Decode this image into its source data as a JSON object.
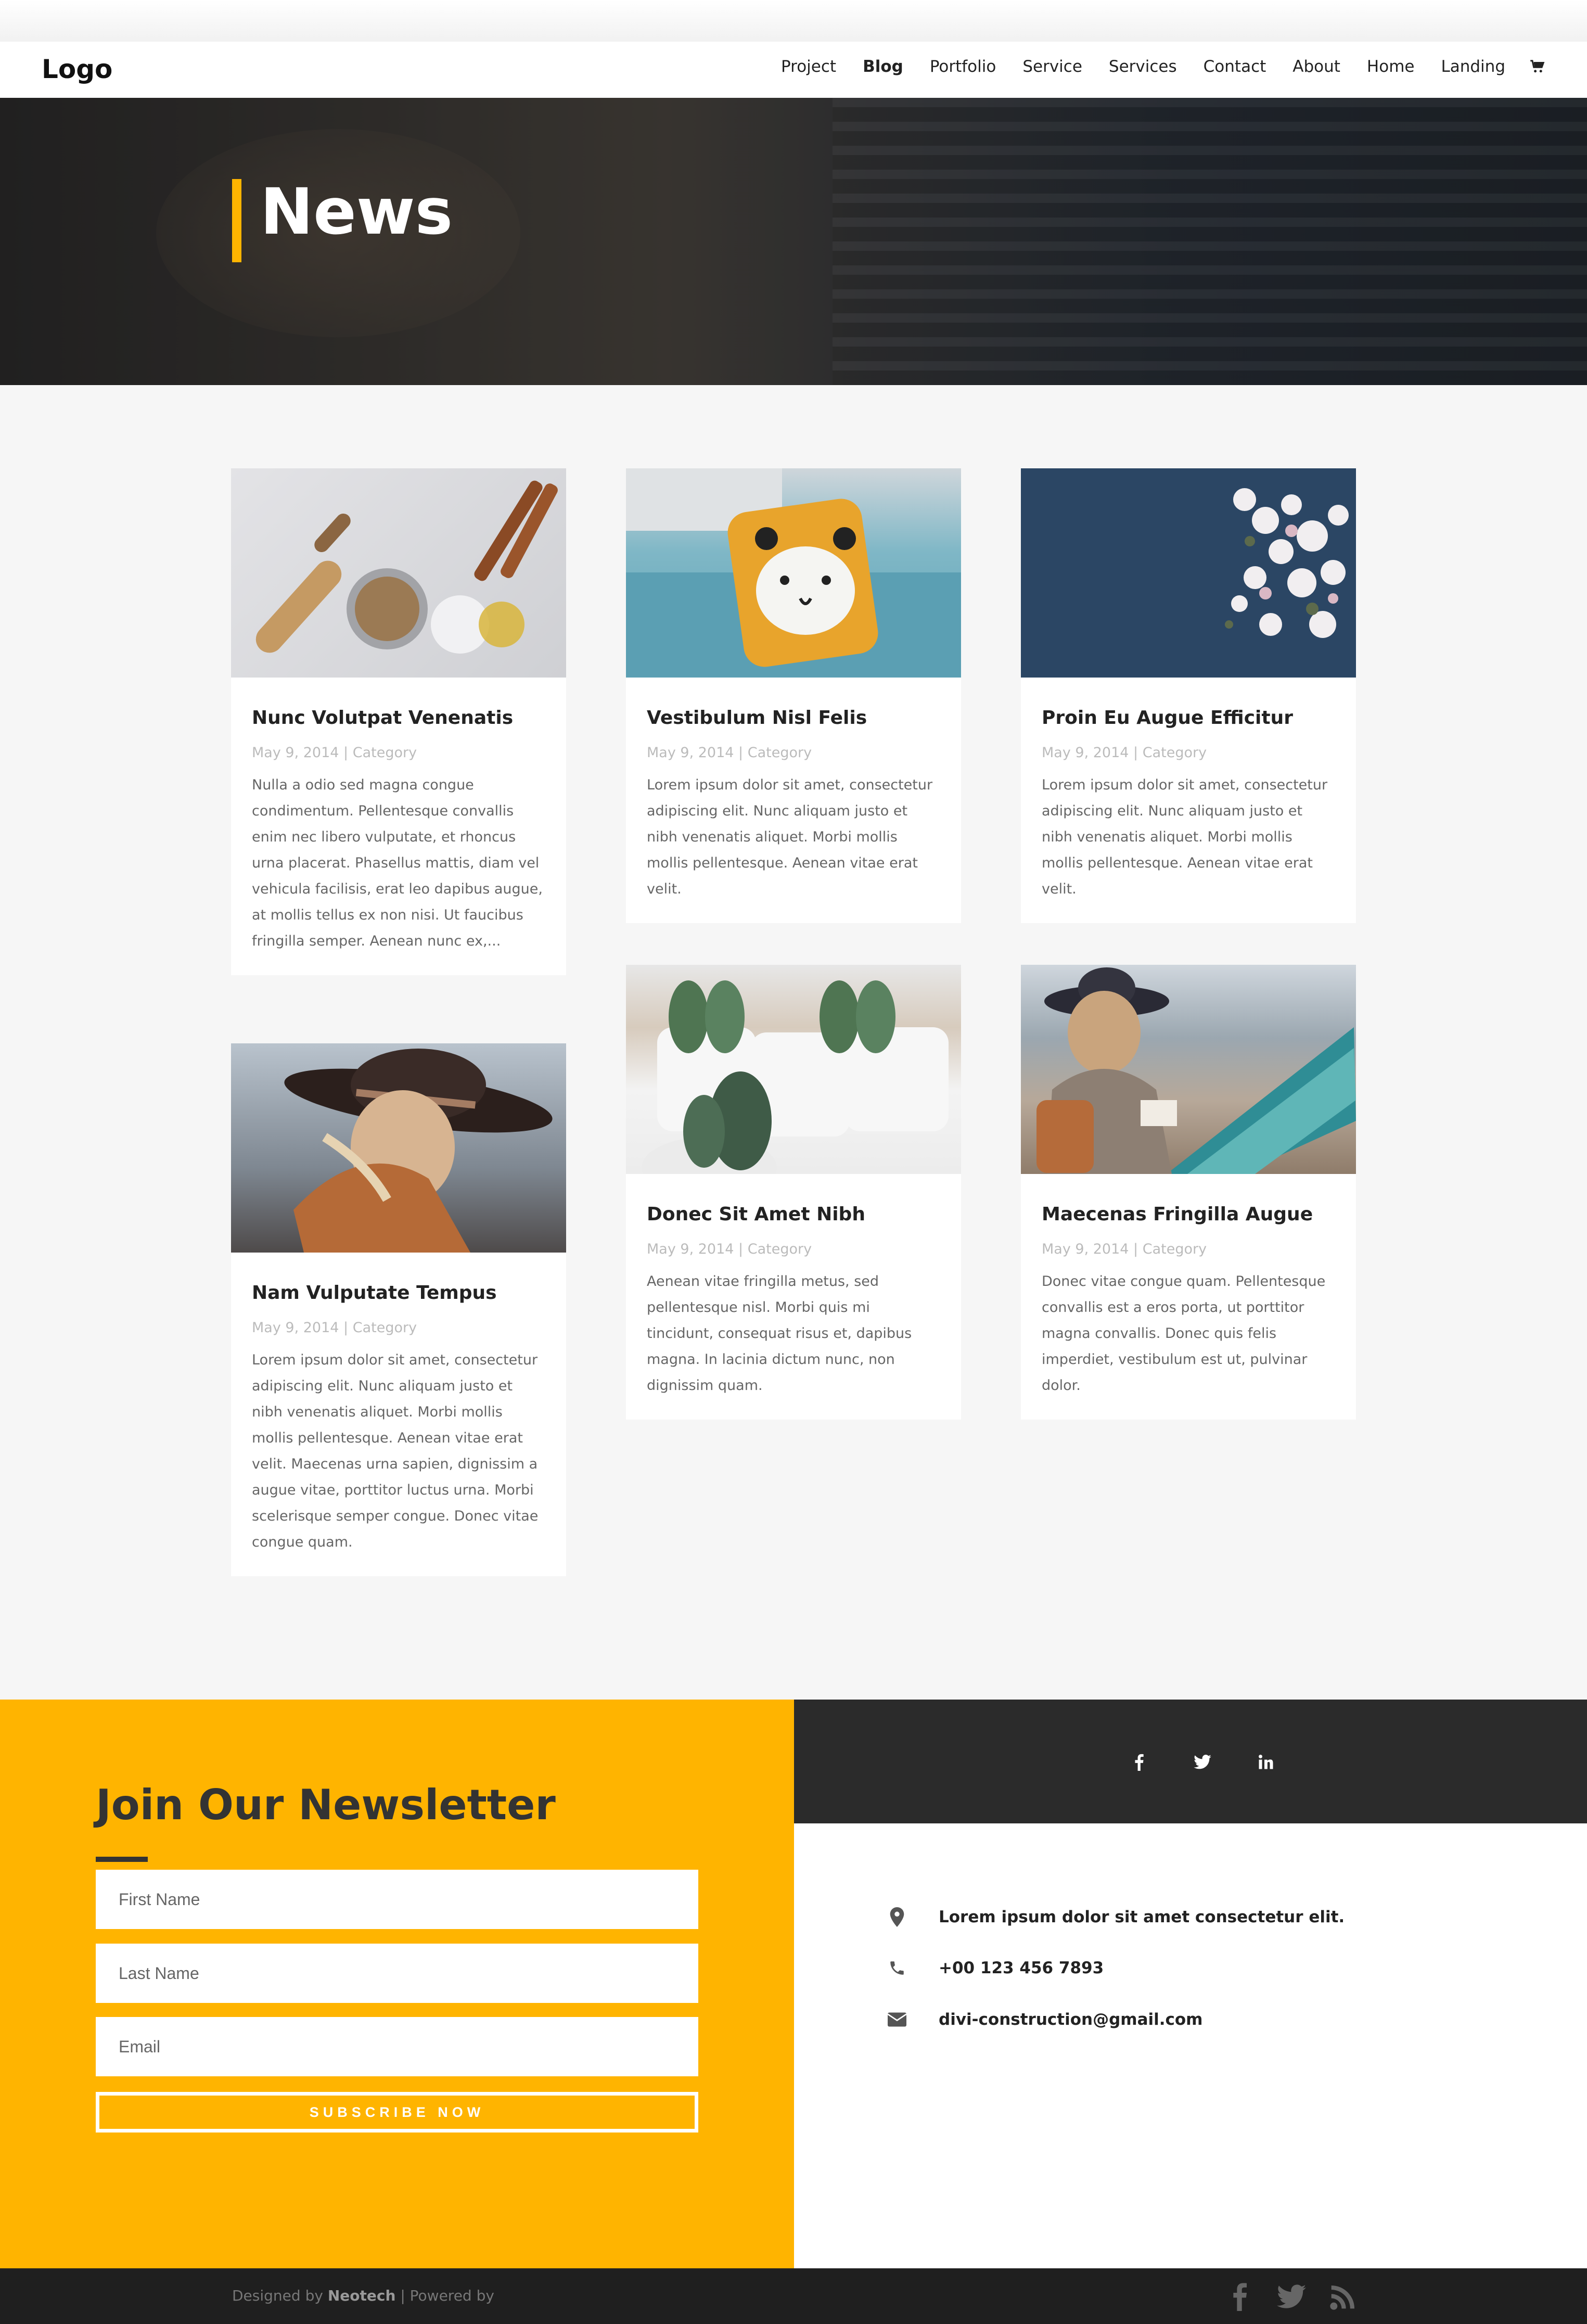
{
  "header": {
    "logo": "Logo",
    "nav": [
      "Project",
      "Blog",
      "Portfolio",
      "Service",
      "Services",
      "Contact",
      "About",
      "Home",
      "Landing"
    ],
    "active": "Blog"
  },
  "hero": {
    "title": "News"
  },
  "colors": {
    "accent": "#ffb400",
    "dark": "#2b2b2b",
    "footer": "#1f1f1f"
  },
  "posts": [
    {
      "title": "Nunc Volutpat Venenatis",
      "meta": "May 9, 2014 | Category",
      "excerpt": "Nulla a odio sed magna congue condimentum. Pellentesque convallis enim nec libero vulputate, et rhoncus urna placerat. Phasellus mattis, diam vel vehicula facilisis, erat leo dapibus augue, at mollis tellus ex non nisi. Ut faucibus fringilla semper. Aenean nunc ex,..."
    },
    {
      "title": "Vestibulum Nisl Felis",
      "meta": "May 9, 2014 | Category",
      "excerpt": "Lorem ipsum dolor sit amet, consectetur adipiscing elit. Nunc aliquam justo et nibh venenatis aliquet. Morbi mollis mollis pellentesque. Aenean vitae erat velit."
    },
    {
      "title": "Proin Eu Augue Efficitur",
      "meta": "May 9, 2014 | Category",
      "excerpt": "Lorem ipsum dolor sit amet, consectetur adipiscing elit. Nunc aliquam justo et nibh venenatis aliquet. Morbi mollis mollis pellentesque. Aenean vitae erat velit."
    },
    {
      "title": "Nam Vulputate Tempus",
      "meta": "May 9, 2014 | Category",
      "excerpt": "Lorem ipsum dolor sit amet, consectetur adipiscing elit. Nunc aliquam justo et nibh venenatis aliquet. Morbi mollis mollis pellentesque. Aenean vitae erat velit. Maecenas urna sapien, dignissim a augue vitae, porttitor luctus urna. Morbi scelerisque semper congue. Donec vitae congue quam."
    },
    {
      "title": "Donec Sit Amet Nibh",
      "meta": "May 9, 2014 | Category",
      "excerpt": "Aenean vitae fringilla metus, sed pellentesque nisl. Morbi quis mi tincidunt, consequat risus et, dapibus magna. In lacinia dictum nunc, non dignissim quam."
    },
    {
      "title": "Maecenas Fringilla Augue",
      "meta": "May 9, 2014 | Category",
      "excerpt": "Donec vitae congue quam. Pellentesque convallis est a eros porta, ut porttitor magna convallis. Donec quis felis imperdiet, vestibulum est ut, pulvinar dolor."
    }
  ],
  "newsletter": {
    "title": "Join Our Newsletter",
    "first_name_placeholder": "First Name",
    "last_name_placeholder": "Last Name",
    "email_placeholder": "Email",
    "button": "SUBSCRIBE NOW"
  },
  "contact": {
    "address": "Lorem ipsum dolor sit amet consectetur elit.",
    "phone": "+00 123 456 7893",
    "email": "divi-construction@gmail.com"
  },
  "footer": {
    "designed_by": "Designed by",
    "brand": "Neotech",
    "powered": "| Powered by"
  }
}
